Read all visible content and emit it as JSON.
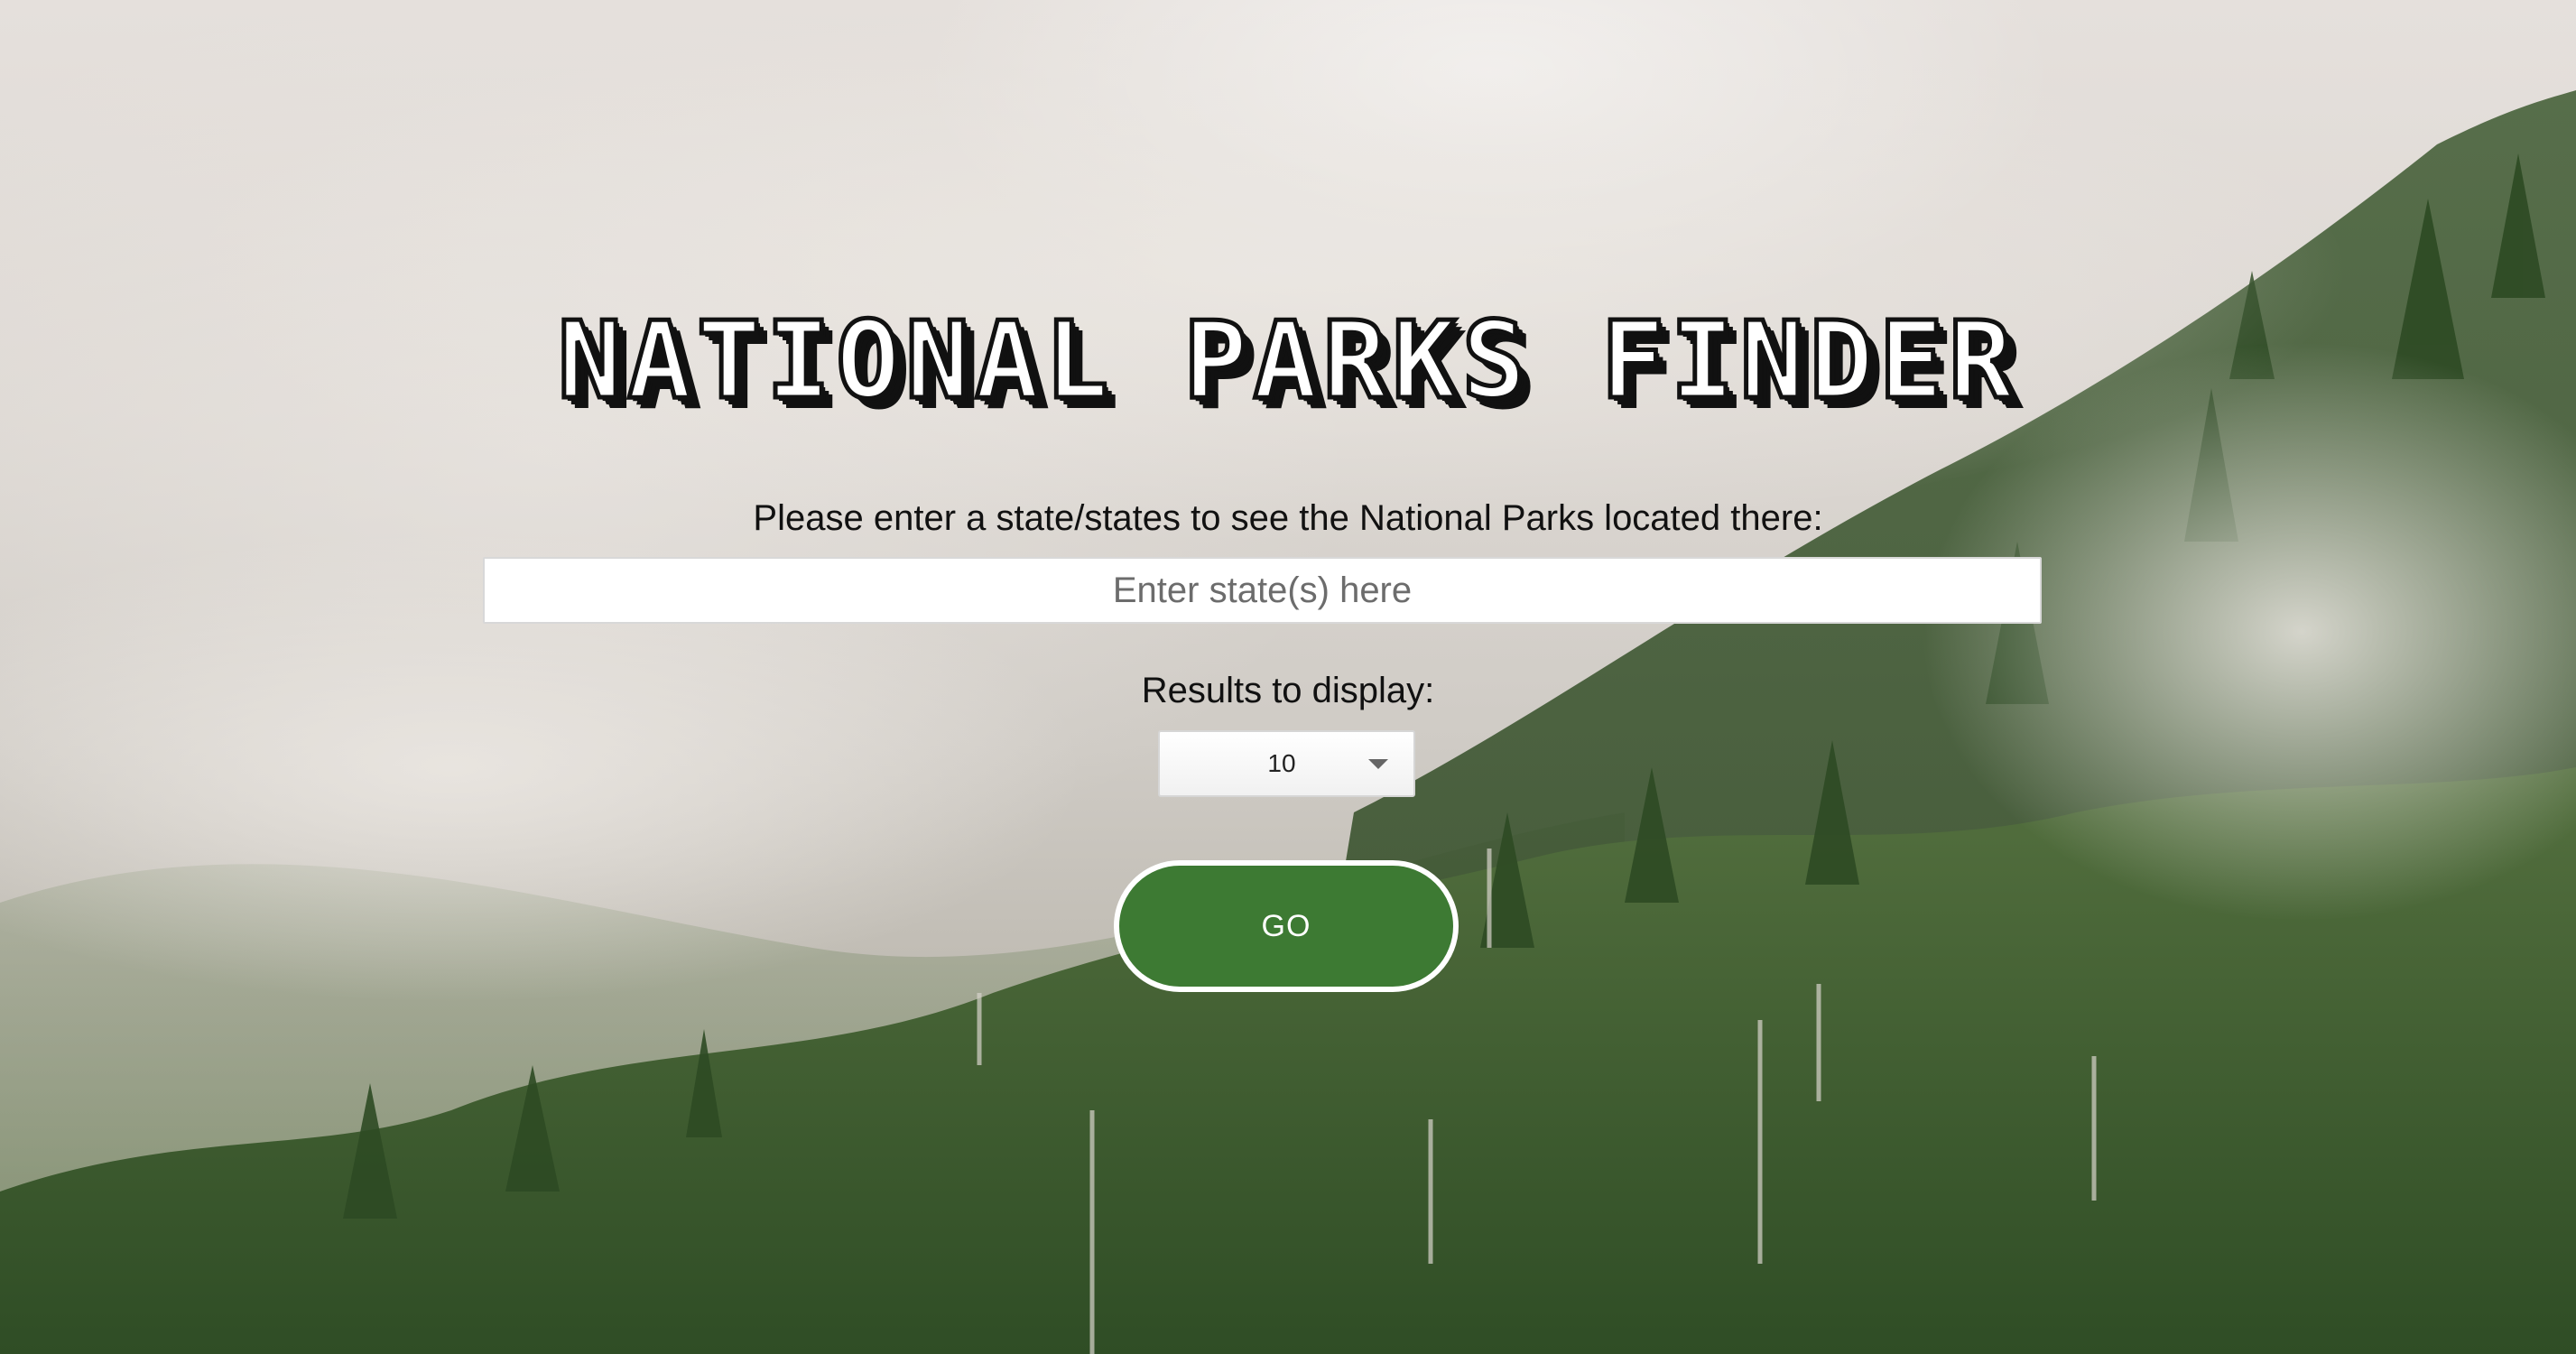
{
  "header": {
    "title": "NATIONAL PARKS FINDER"
  },
  "search": {
    "prompt": "Please enter a state/states to see the National Parks located there:",
    "placeholder": "Enter state(s) here",
    "value": ""
  },
  "results": {
    "label": "Results to display:",
    "selected": "10"
  },
  "actions": {
    "go_label": "GO"
  },
  "colors": {
    "button_bg": "#3d7a33",
    "button_border": "#ffffff",
    "title_outline": "#111111"
  },
  "background": {
    "subject": "misty forested mountainside"
  }
}
